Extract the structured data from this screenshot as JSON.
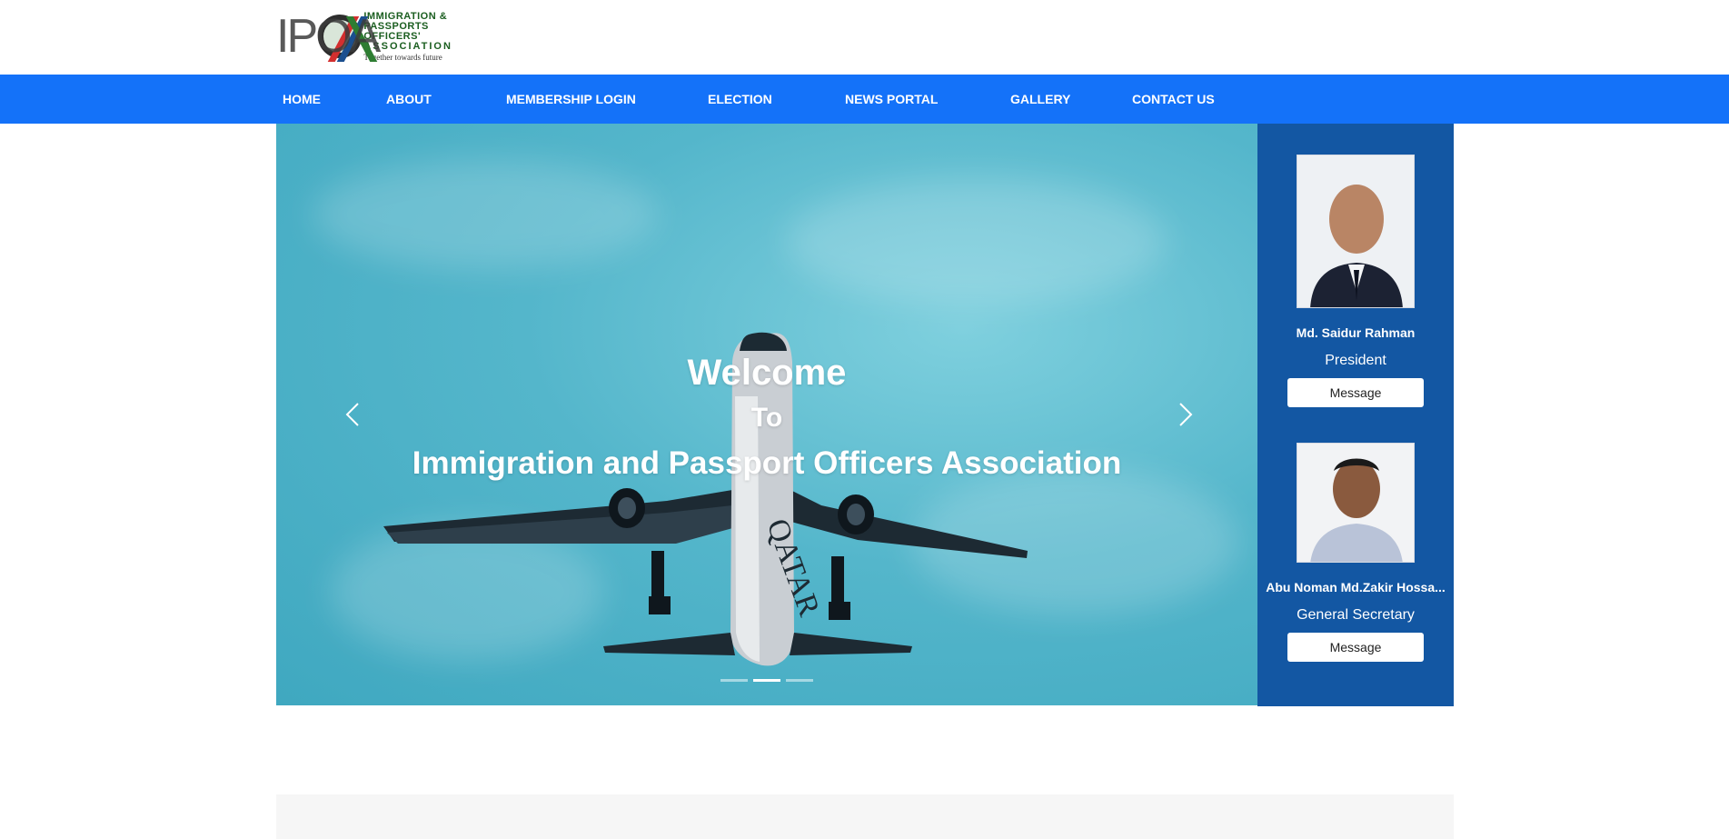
{
  "logo": {
    "letters": "IPOA",
    "lines": [
      "IMMIGRATION &",
      "PASSPORTS OFFICERS'",
      "ASSOCIATION"
    ],
    "tagline": "Together towards future"
  },
  "nav": {
    "items": [
      {
        "label": "HOME"
      },
      {
        "label": "ABOUT"
      },
      {
        "label": "MEMBERSHIP LOGIN"
      },
      {
        "label": "ELECTION"
      },
      {
        "label": "NEWS PORTAL"
      },
      {
        "label": "GALLERY"
      },
      {
        "label": "CONTACT US"
      }
    ],
    "background": "#1472f9"
  },
  "hero": {
    "welcome": "Welcome",
    "to": "To",
    "title": "Immigration and Passport Officers Association",
    "slide_count": 3,
    "active_slide": 2,
    "airline_text": "QATAR",
    "prev_icon": "chevron-left-icon",
    "next_icon": "chevron-right-icon"
  },
  "sidebar": {
    "background": "#1357a3",
    "people": [
      {
        "name": "Md. Saidur Rahman",
        "role": "President",
        "button": "Message"
      },
      {
        "name": "Abu Noman Md.Zakir Hossa...",
        "role": "General Secretary",
        "button": "Message"
      }
    ]
  }
}
